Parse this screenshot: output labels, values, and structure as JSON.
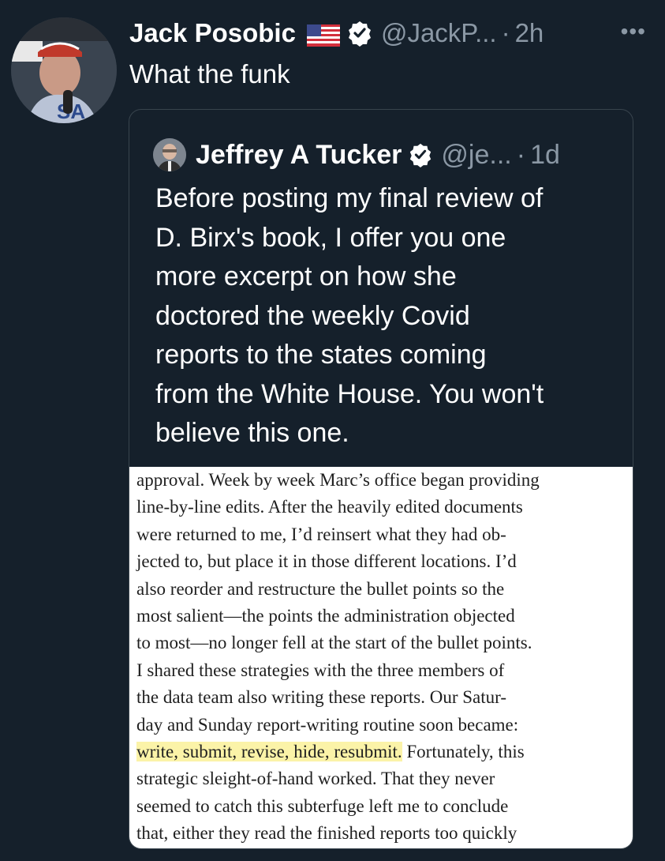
{
  "tweet": {
    "author_name": "Jack Posobic",
    "handle": "@JackP...",
    "separator": "·",
    "time": "2h",
    "more_icon": "•••",
    "text": "What the funk",
    "flag_icon": "us-flag-icon",
    "verified_icon": "verified-badge-icon"
  },
  "quoted": {
    "author_name": "Jeffrey A Tucker",
    "handle": "@je...",
    "separator": "·",
    "time": "1d",
    "text_lines": [
      "Before posting my final review of",
      "D. Birx's book, I offer you one",
      "more excerpt on how she",
      "doctored the weekly Covid",
      "reports to the states coming",
      "from the White House. You won't",
      "believe this one."
    ],
    "excerpt_lines": [
      "approval. Week by week Marc’s office began providing",
      "line-by-line edits. After the heavily edited documents",
      "were returned to me, I’d reinsert what they had ob-",
      "jected to, but place it in those different locations. I’d",
      "also reorder and restructure the bullet points so the",
      "most salient—the points the administration objected",
      "to most—no longer fell at the start of the bullet points.",
      "I shared these strategies with the three members of",
      "the data team also writing these reports. Our Satur-",
      "day and Sunday report-writing routine soon became:"
    ],
    "excerpt_highlight": "write, submit, revise, hide, resubmit.",
    "excerpt_highlight_rest": " Fortunately, this",
    "excerpt_lines_after": [
      "strategic sleight-of-hand worked. That they never",
      "seemed to catch this subterfuge left me to conclude",
      "that, either they read the finished reports too quickly"
    ],
    "highlight_color": "#fbf3a8"
  },
  "colors": {
    "background": "#15202b",
    "secondary_text": "#8b98a5",
    "verified_blue": "#ffffff"
  }
}
